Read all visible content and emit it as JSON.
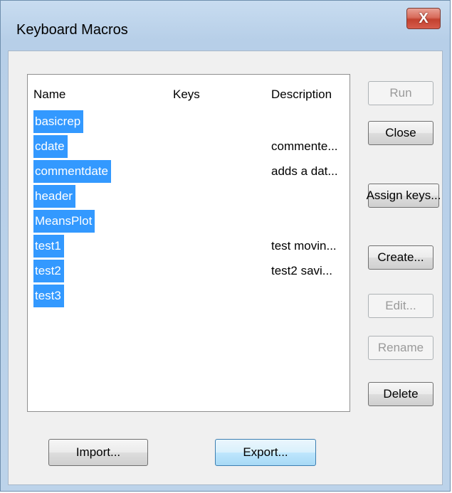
{
  "window": {
    "title": "Keyboard Macros",
    "close_label": "X"
  },
  "list": {
    "columns": [
      "Name",
      "Keys",
      "Description"
    ],
    "rows": [
      {
        "name": "basicrep",
        "keys": "",
        "description": ""
      },
      {
        "name": "cdate",
        "keys": "",
        "description": "commente..."
      },
      {
        "name": "commentdate",
        "keys": "",
        "description": "adds a dat..."
      },
      {
        "name": "header",
        "keys": "",
        "description": ""
      },
      {
        "name": "MeansPlot",
        "keys": "",
        "description": ""
      },
      {
        "name": "test1",
        "keys": "",
        "description": "test movin..."
      },
      {
        "name": "test2",
        "keys": "",
        "description": "test2 savi..."
      },
      {
        "name": "test3",
        "keys": "",
        "description": ""
      }
    ]
  },
  "buttons": {
    "run": "Run",
    "close": "Close",
    "assign_keys": "Assign keys...",
    "create": "Create...",
    "edit": "Edit...",
    "rename": "Rename",
    "delete": "Delete",
    "import": "Import...",
    "export": "Export..."
  },
  "colors": {
    "selection": "#3399ff",
    "close_button": "#c2412f"
  }
}
